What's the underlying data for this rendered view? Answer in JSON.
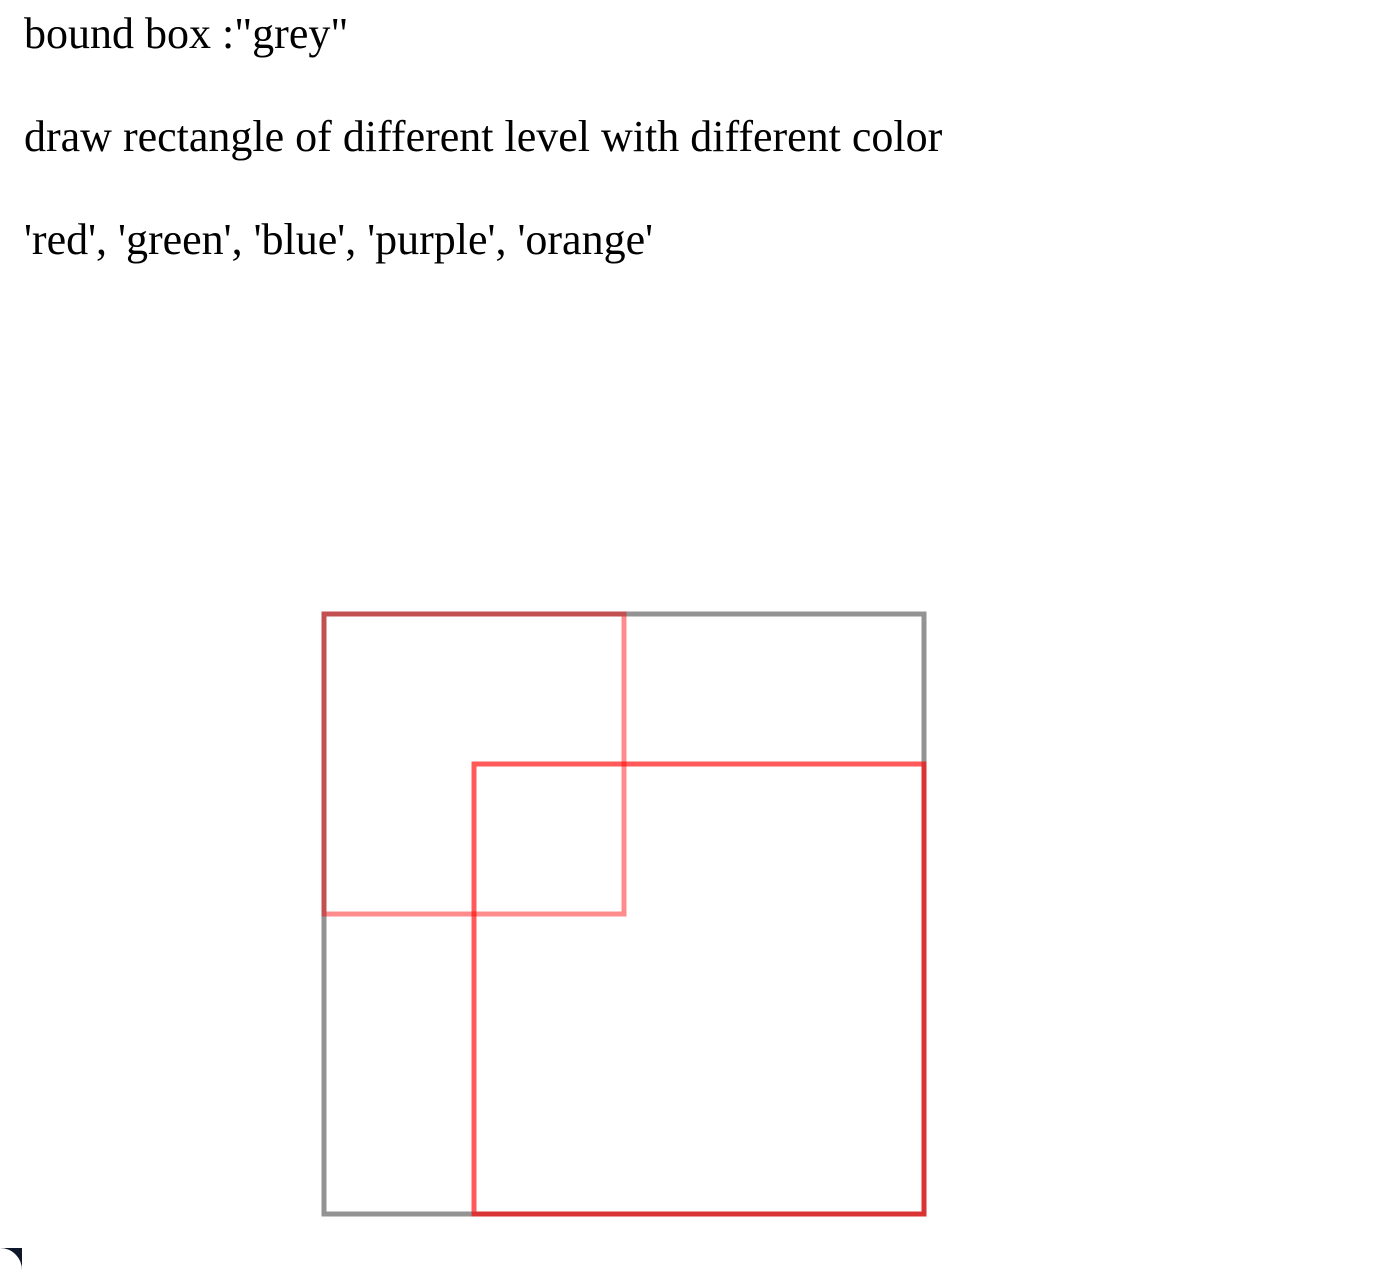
{
  "text": {
    "line1": "bound box :\"grey\"",
    "line2": "draw rectangle of different level with different color",
    "line3": "'red', 'green', 'blue', 'purple', 'orange'"
  },
  "colors": {
    "bound_box": "#808080",
    "level_1": "#ff0000",
    "background": "#ffffff"
  },
  "rectangles": [
    {
      "name": "bound-box-rect",
      "color": "#808080",
      "opacity": 0.85
    },
    {
      "name": "red-rect-top-left",
      "color": "#ff0000",
      "opacity": 0.45
    },
    {
      "name": "red-rect-bottom-right",
      "color": "#ff0000",
      "opacity": 0.65
    }
  ]
}
